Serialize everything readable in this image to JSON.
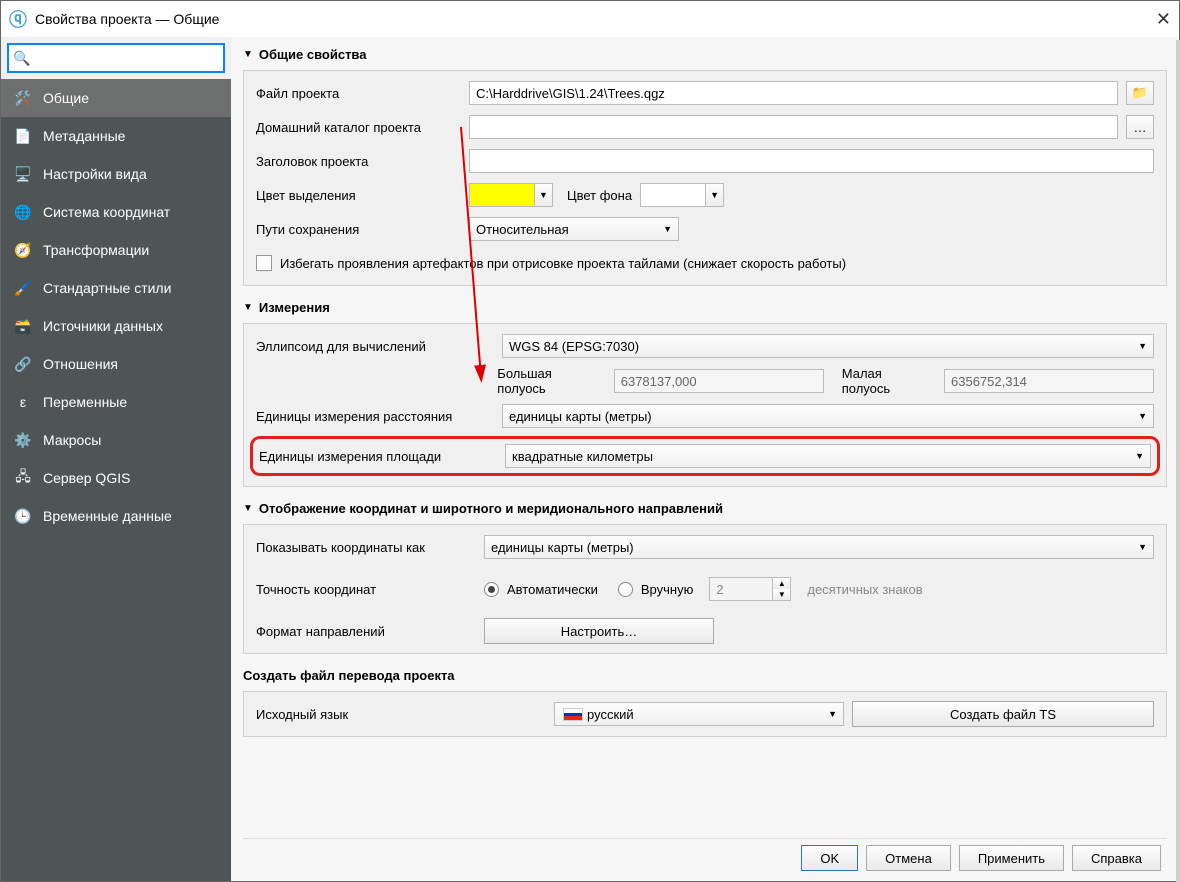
{
  "title": "Свойства проекта — Общие",
  "search_placeholder": "",
  "sidebar": {
    "items": [
      {
        "label": "Общие"
      },
      {
        "label": "Метаданные"
      },
      {
        "label": "Настройки вида"
      },
      {
        "label": "Система координат"
      },
      {
        "label": "Трансформации"
      },
      {
        "label": "Стандартные стили"
      },
      {
        "label": "Источники данных"
      },
      {
        "label": "Отношения"
      },
      {
        "label": "Переменные"
      },
      {
        "label": "Макросы"
      },
      {
        "label": "Сервер QGIS"
      },
      {
        "label": "Временные данные"
      }
    ]
  },
  "sections": {
    "general": {
      "title": "Общие свойства",
      "project_file_label": "Файл проекта",
      "project_file_value": "C:\\Harddrive\\GIS\\1.24\\Trees.qgz",
      "home_dir_label": "Домашний каталог проекта",
      "home_dir_value": "",
      "project_title_label": "Заголовок проекта",
      "project_title_value": "",
      "selection_color_label": "Цвет выделения",
      "selection_color": "#ffff00",
      "bg_color_label": "Цвет фона",
      "bg_color": "#ffffff",
      "save_paths_label": "Пути сохранения",
      "save_paths_value": "Относительная",
      "avoid_artifacts_label": "Избегать проявления артефактов при отрисовке проекта тайлами (снижает скорость работы)"
    },
    "measurements": {
      "title": "Измерения",
      "ellipsoid_label": "Эллипсоид для вычислений",
      "ellipsoid_value": "WGS 84 (EPSG:7030)",
      "semi_major_label": "Большая полуось",
      "semi_major_value": "6378137,000",
      "semi_minor_label": "Малая полуось",
      "semi_minor_value": "6356752,314",
      "distance_units_label": "Единицы измерения расстояния",
      "distance_units_value": "единицы карты (метры)",
      "area_units_label": "Единицы измерения площади",
      "area_units_value": "квадратные километры"
    },
    "coords": {
      "title": "Отображение координат и широтного и меридионального направлений",
      "show_as_label": "Показывать координаты как",
      "show_as_value": "единицы карты (метры)",
      "precision_label": "Точность координат",
      "precision_auto": "Автоматически",
      "precision_manual": "Вручную",
      "precision_value": "2",
      "precision_suffix": "десятичных знаков",
      "bearing_label": "Формат направлений",
      "bearing_button": "Настроить…"
    },
    "translation": {
      "title": "Создать файл перевода проекта",
      "source_lang_label": "Исходный язык",
      "source_lang_value": "русский",
      "generate_button": "Создать файл TS"
    }
  },
  "buttons": {
    "ok": "OK",
    "cancel": "Отмена",
    "apply": "Применить",
    "help": "Справка"
  },
  "ellipsis": "…"
}
